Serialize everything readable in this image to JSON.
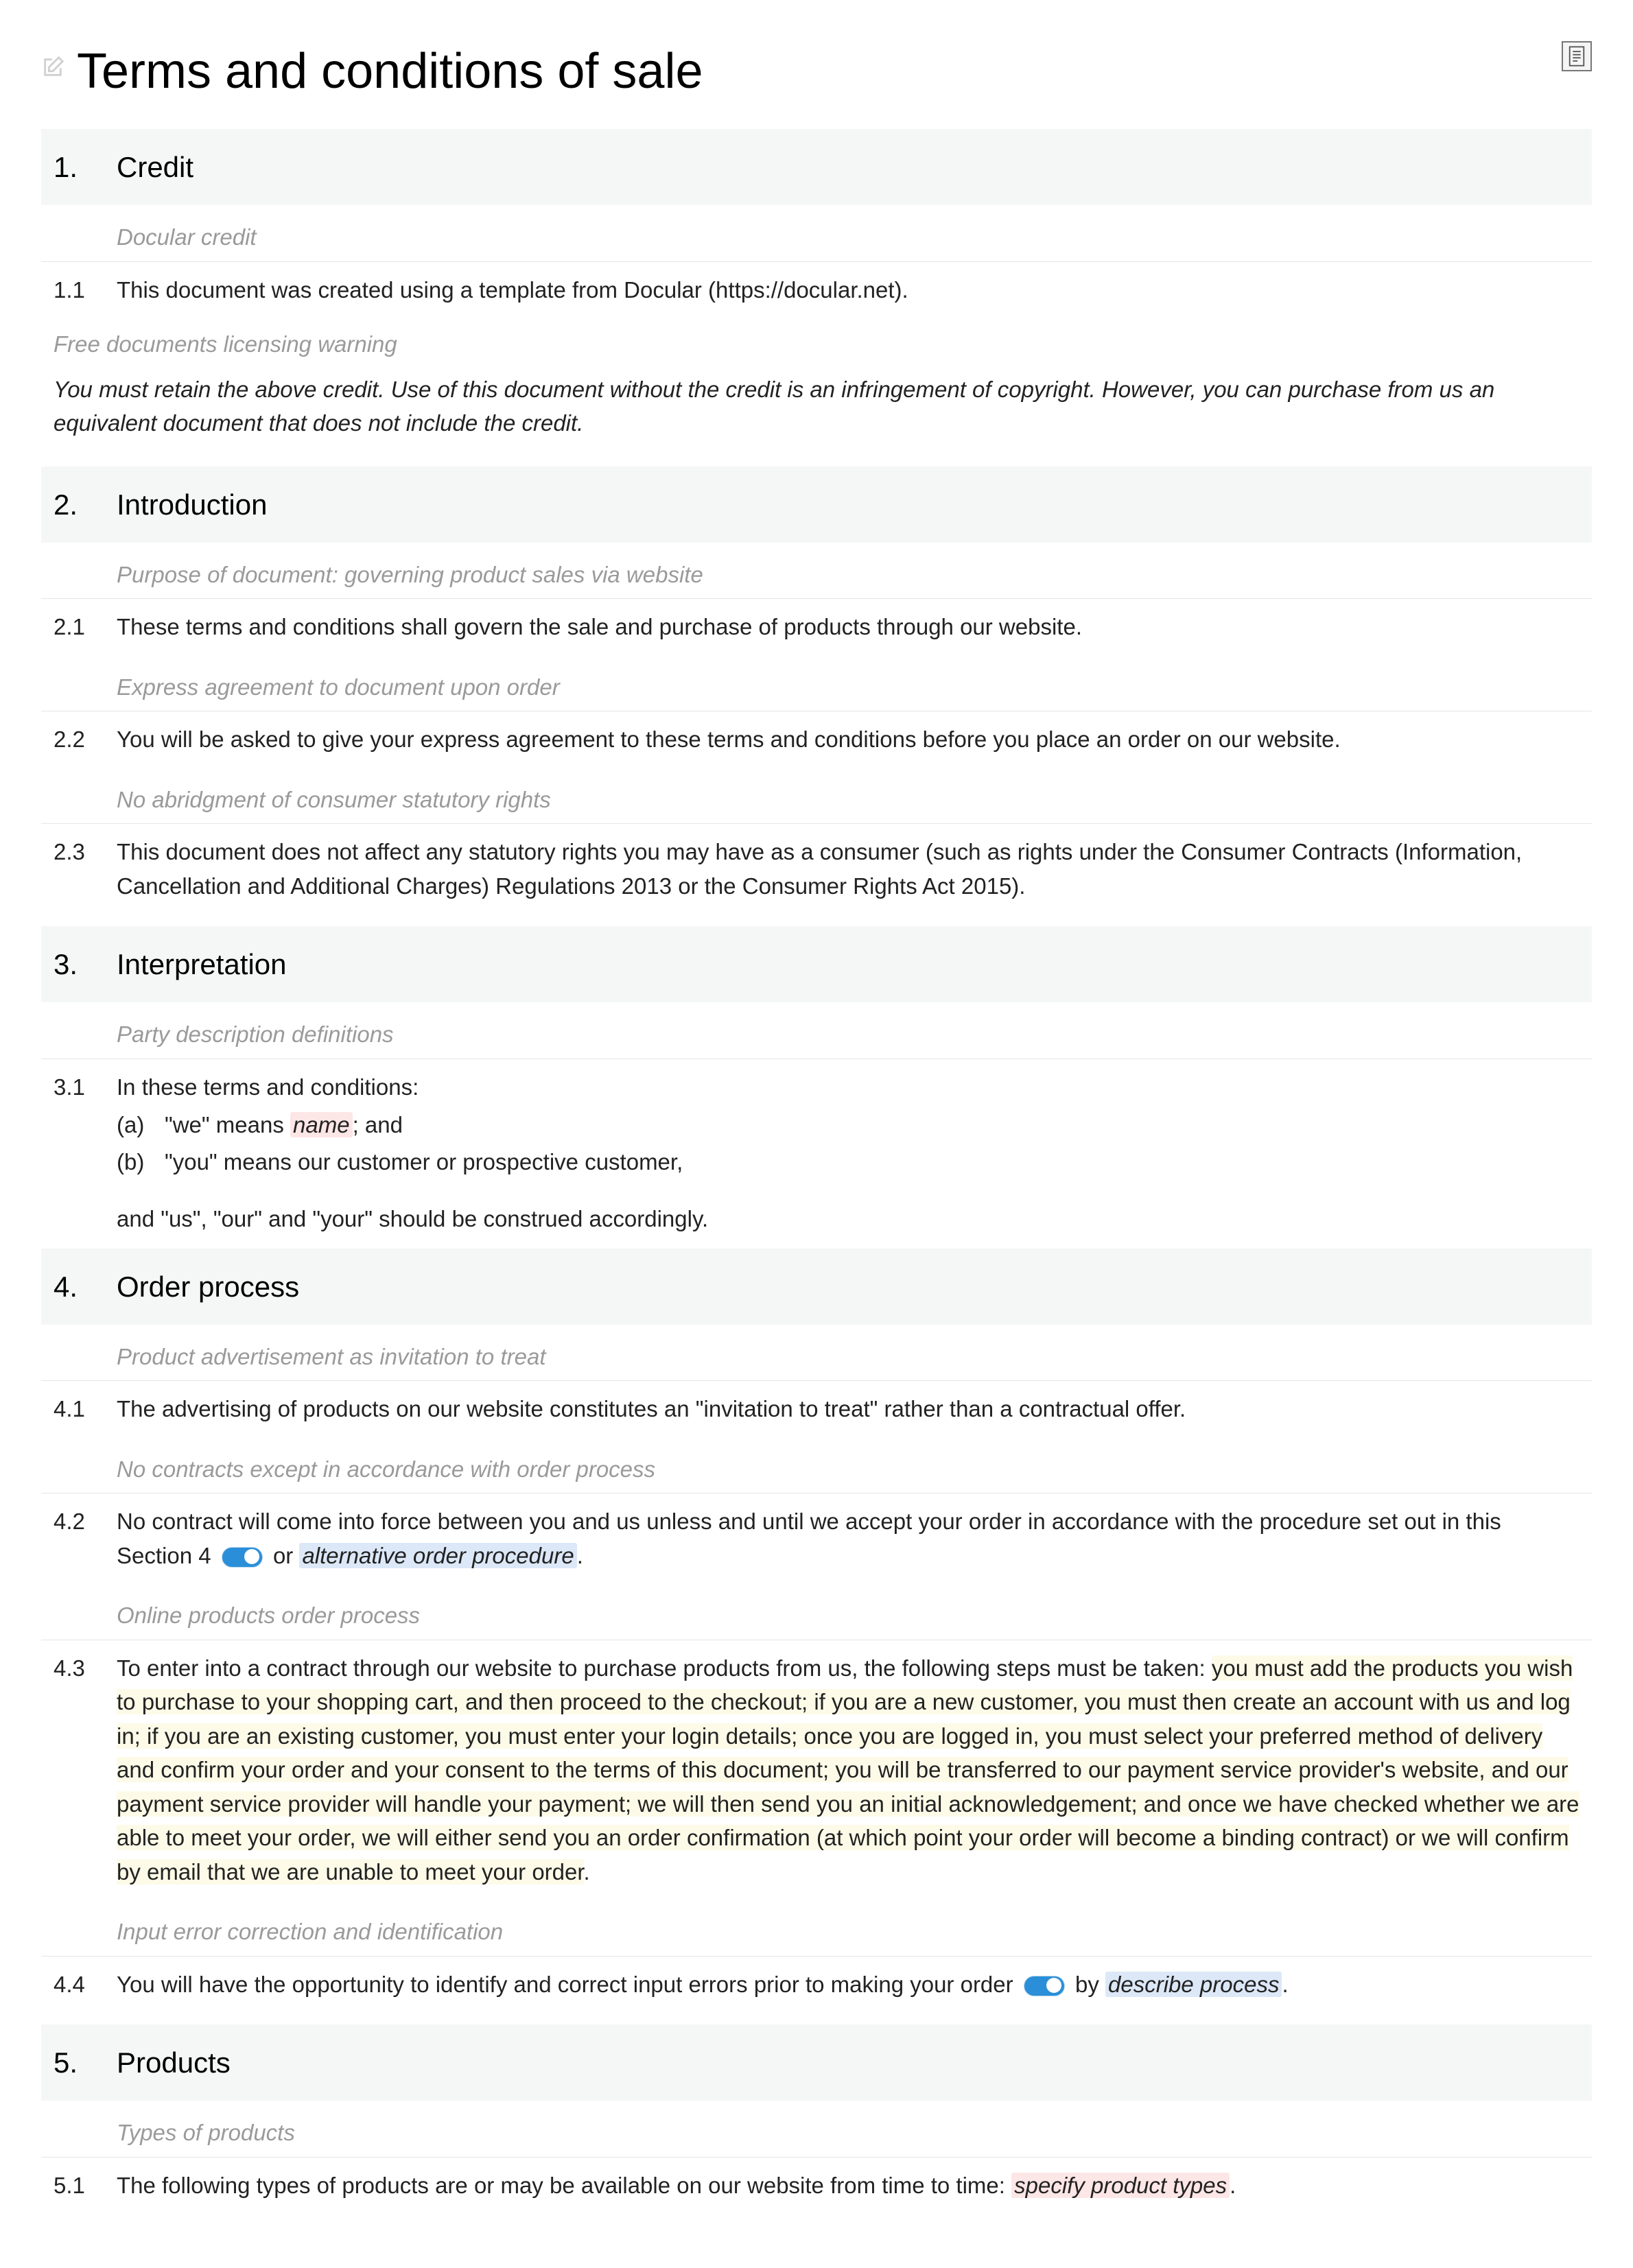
{
  "title": "Terms and conditions of sale",
  "sections": [
    {
      "num": "1.",
      "title": "Credit"
    },
    {
      "num": "2.",
      "title": "Introduction"
    },
    {
      "num": "3.",
      "title": "Interpretation"
    },
    {
      "num": "4.",
      "title": "Order process"
    },
    {
      "num": "5.",
      "title": "Products"
    }
  ],
  "notes": {
    "n1": "Docular credit",
    "n2": "Free documents licensing warning",
    "n3": "Purpose of document: governing product sales via website",
    "n4": "Express agreement to document upon order",
    "n5": "No abridgment of consumer statutory rights",
    "n6": "Party description definitions",
    "n7": "Product advertisement as invitation to treat",
    "n8": "No contracts except in accordance with order process",
    "n9": "Online products order process",
    "n10": "Input error correction and identification",
    "n11": "Types of products"
  },
  "clauses": {
    "c1_1_num": "1.1",
    "c1_1": "This document was created using a template from Docular (https://docular.net).",
    "warning": "You must retain the above credit. Use of this document without the credit is an infringement of copyright. However, you can purchase from us an equivalent document that does not include the credit.",
    "c2_1_num": "2.1",
    "c2_1": "These terms and conditions shall govern the sale and purchase of products through our website.",
    "c2_2_num": "2.2",
    "c2_2": "You will be asked to give your express agreement to these terms and conditions before you place an order on our website.",
    "c2_3_num": "2.3",
    "c2_3": "This document does not affect any statutory rights you may have as a consumer (such as rights under the Consumer Contracts (Information, Cancellation and Additional Charges) Regulations 2013 or the Consumer Rights Act 2015).",
    "c3_1_num": "3.1",
    "c3_1_intro": "In these terms and conditions:",
    "c3_1_a_pre": "\"we\" means ",
    "c3_1_a_placeholder": "name",
    "c3_1_a_post": "; and",
    "c3_1_b": "\"you\" means our customer or prospective customer,",
    "c3_1_tail": "and \"us\", \"our\" and \"your\" should be construed accordingly.",
    "c4_1_num": "4.1",
    "c4_1": "The advertising of products on our website constitutes an \"invitation to treat\" rather than a contractual offer.",
    "c4_2_num": "4.2",
    "c4_2_pre": "No contract will come into force between you and us unless and until we accept your order in accordance with the procedure set out in this Section 4",
    "c4_2_mid": " or ",
    "c4_2_placeholder": "alternative order procedure",
    "c4_2_post": ".",
    "c4_3_num": "4.3",
    "c4_3_pre": "To enter into a contract through our website to purchase products from us, the following steps must be taken: ",
    "c4_3_hl": "you must add the products you wish to purchase to your shopping cart, and then proceed to the checkout; if you are a new customer, you must then create an account with us and log in; if you are an existing customer, you must enter your login details; once you are logged in, you must select your preferred method of delivery and confirm your order and your consent to the terms of this document; you will be transferred to our payment service provider's website, and our payment service provider will handle your payment; we will then send you an initial acknowledgement; and once we have checked whether we are able to meet your order, we will either send you an order confirmation (at which point your order will become a binding contract) or we will confirm by email that we are unable to meet your order",
    "c4_3_post": ".",
    "c4_4_num": "4.4",
    "c4_4_pre": "You will have the opportunity to identify and correct input errors prior to making your order",
    "c4_4_mid": " by ",
    "c4_4_placeholder": "describe process",
    "c4_4_post": ".",
    "c5_1_num": "5.1",
    "c5_1_pre": "The following types of products are or may be available on our website from time to time: ",
    "c5_1_placeholder": "specify product types",
    "c5_1_post": "."
  },
  "sub_labels": {
    "a": "(a)",
    "b": "(b)"
  }
}
